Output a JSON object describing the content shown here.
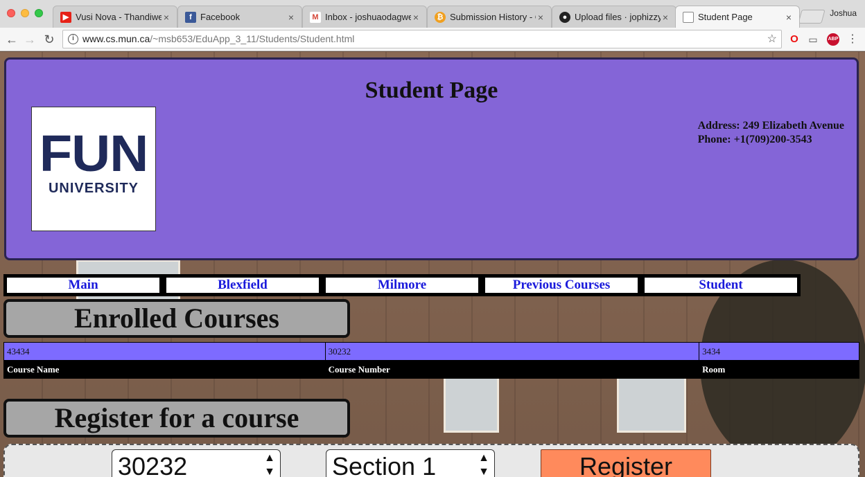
{
  "browser": {
    "tabs": [
      {
        "title": "Vusi Nova - Thandiwe",
        "icon": "youtube-icon"
      },
      {
        "title": "Facebook",
        "icon": "facebook-icon"
      },
      {
        "title": "Inbox - joshuaodagwe",
        "icon": "gmail-icon"
      },
      {
        "title": "Submission History - C",
        "icon": "coin-icon"
      },
      {
        "title": "Upload files · jophizzy",
        "icon": "github-icon"
      },
      {
        "title": "Student Page",
        "icon": "page-icon"
      }
    ],
    "profile_name": "Joshua",
    "url_host": "www.cs.mun.ca",
    "url_path": "/~msb653/EduApp_3_11/Students/Student.html"
  },
  "header": {
    "title": "Student Page",
    "logo_line1": "FUN",
    "logo_line2": "UNIVERSITY",
    "address": "Address: 249 Elizabeth Avenue",
    "phone": "Phone: +1(709)200-3543"
  },
  "nav": {
    "items": [
      "Main",
      "Blexfield",
      "Milmore",
      "Previous Courses",
      "Student"
    ]
  },
  "enrolled": {
    "title": "Enrolled Courses",
    "row": [
      "43434",
      "30232",
      "3434"
    ],
    "columns": [
      "Course Name",
      "Course Number",
      "Room"
    ]
  },
  "register": {
    "title": "Register for a course",
    "course_select_value": "30232",
    "section_select_value": "Section 1",
    "button_label": "Register"
  },
  "colors": {
    "header_bg": "#8465d7",
    "table_row_bg": "#7d6bff",
    "register_button": "#ff8a5c"
  }
}
